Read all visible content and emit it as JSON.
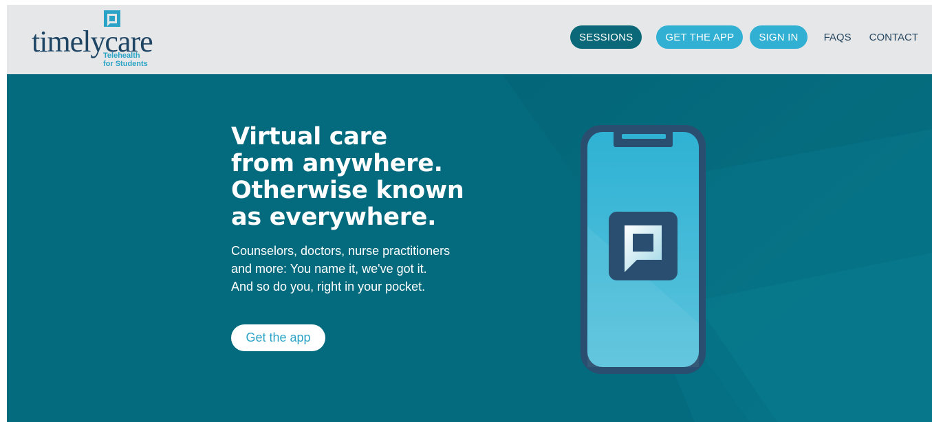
{
  "brand": {
    "wordmark": "timelycare",
    "tagline_line1": "Telehealth",
    "tagline_line2": "for Students"
  },
  "nav": {
    "sessions": "SESSIONS",
    "get_the_app": "GET THE APP",
    "sign_in": "SIGN IN",
    "faqs": "FAQS",
    "contact": "CONTACT"
  },
  "hero": {
    "headline_lines": [
      "Virtual care",
      "from anywhere.",
      "Otherwise known",
      "as everywhere."
    ],
    "subcopy": "Counselors, doctors, nurse practitioners and more: You name it, we've got it. And so do you, right in your pocket.",
    "cta_label": "Get the app"
  },
  "icons": {
    "logo_mark": "speech-bubble-square-icon",
    "phone_illustration": "smartphone-app-icon"
  },
  "colors": {
    "header_bg": "#e6e7e8",
    "hero_bg": "#046b7e",
    "navy": "#1f4565",
    "accent_light": "#31b0d3",
    "accent_dark": "#0b6878"
  }
}
